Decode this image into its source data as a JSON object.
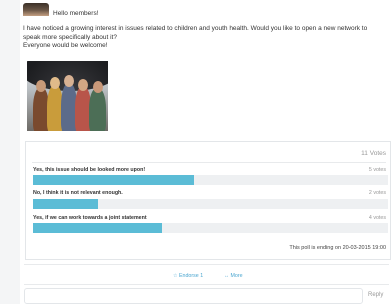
{
  "post": {
    "greeting": "Hello members!",
    "message_lines": [
      "I have noticed a growing interest in issues related to children and youth health. Would you like to open a new network to speak more specifically about it?",
      "Everyone would be welcome!"
    ]
  },
  "poll": {
    "total_votes": "11 Votes",
    "options": [
      {
        "label": "Yes, this issue should be looked more upon!",
        "votes_text": "5 votes",
        "share": 0.4545
      },
      {
        "label": "No, I think it is not relevant enough.",
        "votes_text": "2 votes",
        "share": 0.1818
      },
      {
        "label": "Yes, if we can work towards a joint statement",
        "votes_text": "4 votes",
        "share": 0.3636
      }
    ],
    "ending_text": "This poll is ending on 20-03-2015 19:00"
  },
  "actions": {
    "endorse_label": "Endorse",
    "endorse_count": "1",
    "more_label": "More"
  },
  "reply": {
    "placeholder": "",
    "button_label": "Reply"
  },
  "colors": {
    "bar_fill": "#5bbcd6",
    "bar_track": "#eef0f2",
    "link": "#4aa6d0"
  },
  "icons": {
    "endorse": "star-icon",
    "more": "arrows-icon"
  }
}
